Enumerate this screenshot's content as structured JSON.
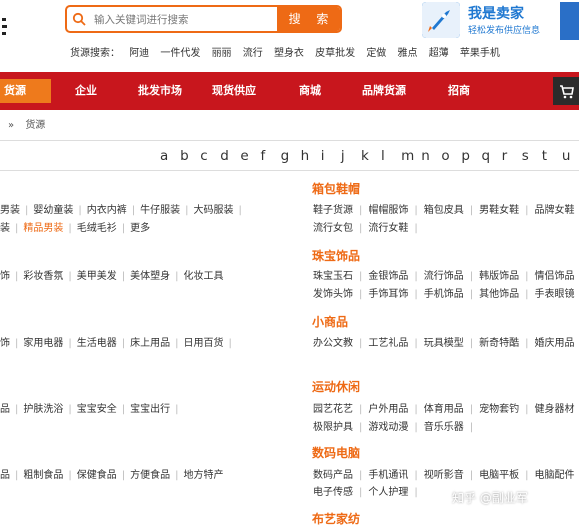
{
  "search": {
    "placeholder": "输入关键词进行搜索",
    "button": "搜 索"
  },
  "seller": {
    "title": "我是卖家",
    "subtitle": "轻松发布供应信息"
  },
  "hot_search": {
    "label": "货源搜索：",
    "items": [
      "阿迪",
      "一件代发",
      "丽丽",
      "流行",
      "塑身衣",
      "皮草批发",
      "定做",
      "雅点",
      "超薄",
      "苹果手机"
    ]
  },
  "nav": {
    "current": "货源",
    "items": [
      "企业",
      "批发市场",
      "现货供应",
      "商城",
      "品牌货源",
      "招商"
    ]
  },
  "breadcrumb": {
    "sep": "»",
    "current": "货源"
  },
  "letters": [
    "a",
    "b",
    "c",
    "d",
    "e",
    "f",
    "g",
    "h",
    "i",
    "j",
    "k",
    "l",
    "m",
    "n",
    "o",
    "p",
    "q",
    "r",
    "s",
    "t",
    "u"
  ],
  "left_rows": [
    [
      "男装",
      "婴幼童装",
      "内衣内裤",
      "牛仔服装",
      "大码服装"
    ],
    [
      "装",
      "精品男装",
      "毛绒毛衫",
      "更多"
    ],
    [
      "饰",
      "彩妆香氛",
      "美甲美发",
      "美体塑身",
      "化妆工具"
    ],
    [
      "饰",
      "家用电器",
      "生活电器",
      "床上用品",
      "日用百货"
    ],
    [
      "品",
      "护肤洗浴",
      "宝宝安全",
      "宝宝出行"
    ],
    [
      "品",
      "粗制食品",
      "保健食品",
      "方便食品",
      "地方特产"
    ]
  ],
  "right_cats": [
    {
      "title": "箱包鞋帽",
      "rows": [
        [
          "鞋子货源",
          "帽帽服饰",
          "箱包皮具",
          "男鞋女鞋",
          "品牌女鞋"
        ],
        [
          "流行女包",
          "流行女鞋"
        ]
      ]
    },
    {
      "title": "珠宝饰品",
      "rows": [
        [
          "珠宝玉石",
          "金银饰品",
          "流行饰品",
          "韩版饰品",
          "情侣饰品"
        ],
        [
          "发饰头饰",
          "手饰耳饰",
          "手机饰品",
          "其他饰品",
          "手表眼镜"
        ]
      ]
    },
    {
      "title": "小商品",
      "rows": [
        [
          "办公文教",
          "工艺礼品",
          "玩具模型",
          "新奇特酷",
          "婚庆用品"
        ]
      ]
    },
    {
      "title": "运动休闲",
      "rows": [
        [
          "园艺花艺",
          "户外用品",
          "体育用品",
          "宠物套钓",
          "健身器材"
        ],
        [
          "极限护具",
          "游戏动漫",
          "音乐乐器"
        ]
      ]
    },
    {
      "title": "数码电脑",
      "rows": [
        [
          "数码产品",
          "手机通讯",
          "视听影音",
          "电脑平板",
          "电脑配件"
        ],
        [
          "电子传感",
          "个人护理"
        ]
      ]
    },
    {
      "title": "布艺家纺",
      "rows": []
    }
  ],
  "watermark": "知乎 @副业军"
}
